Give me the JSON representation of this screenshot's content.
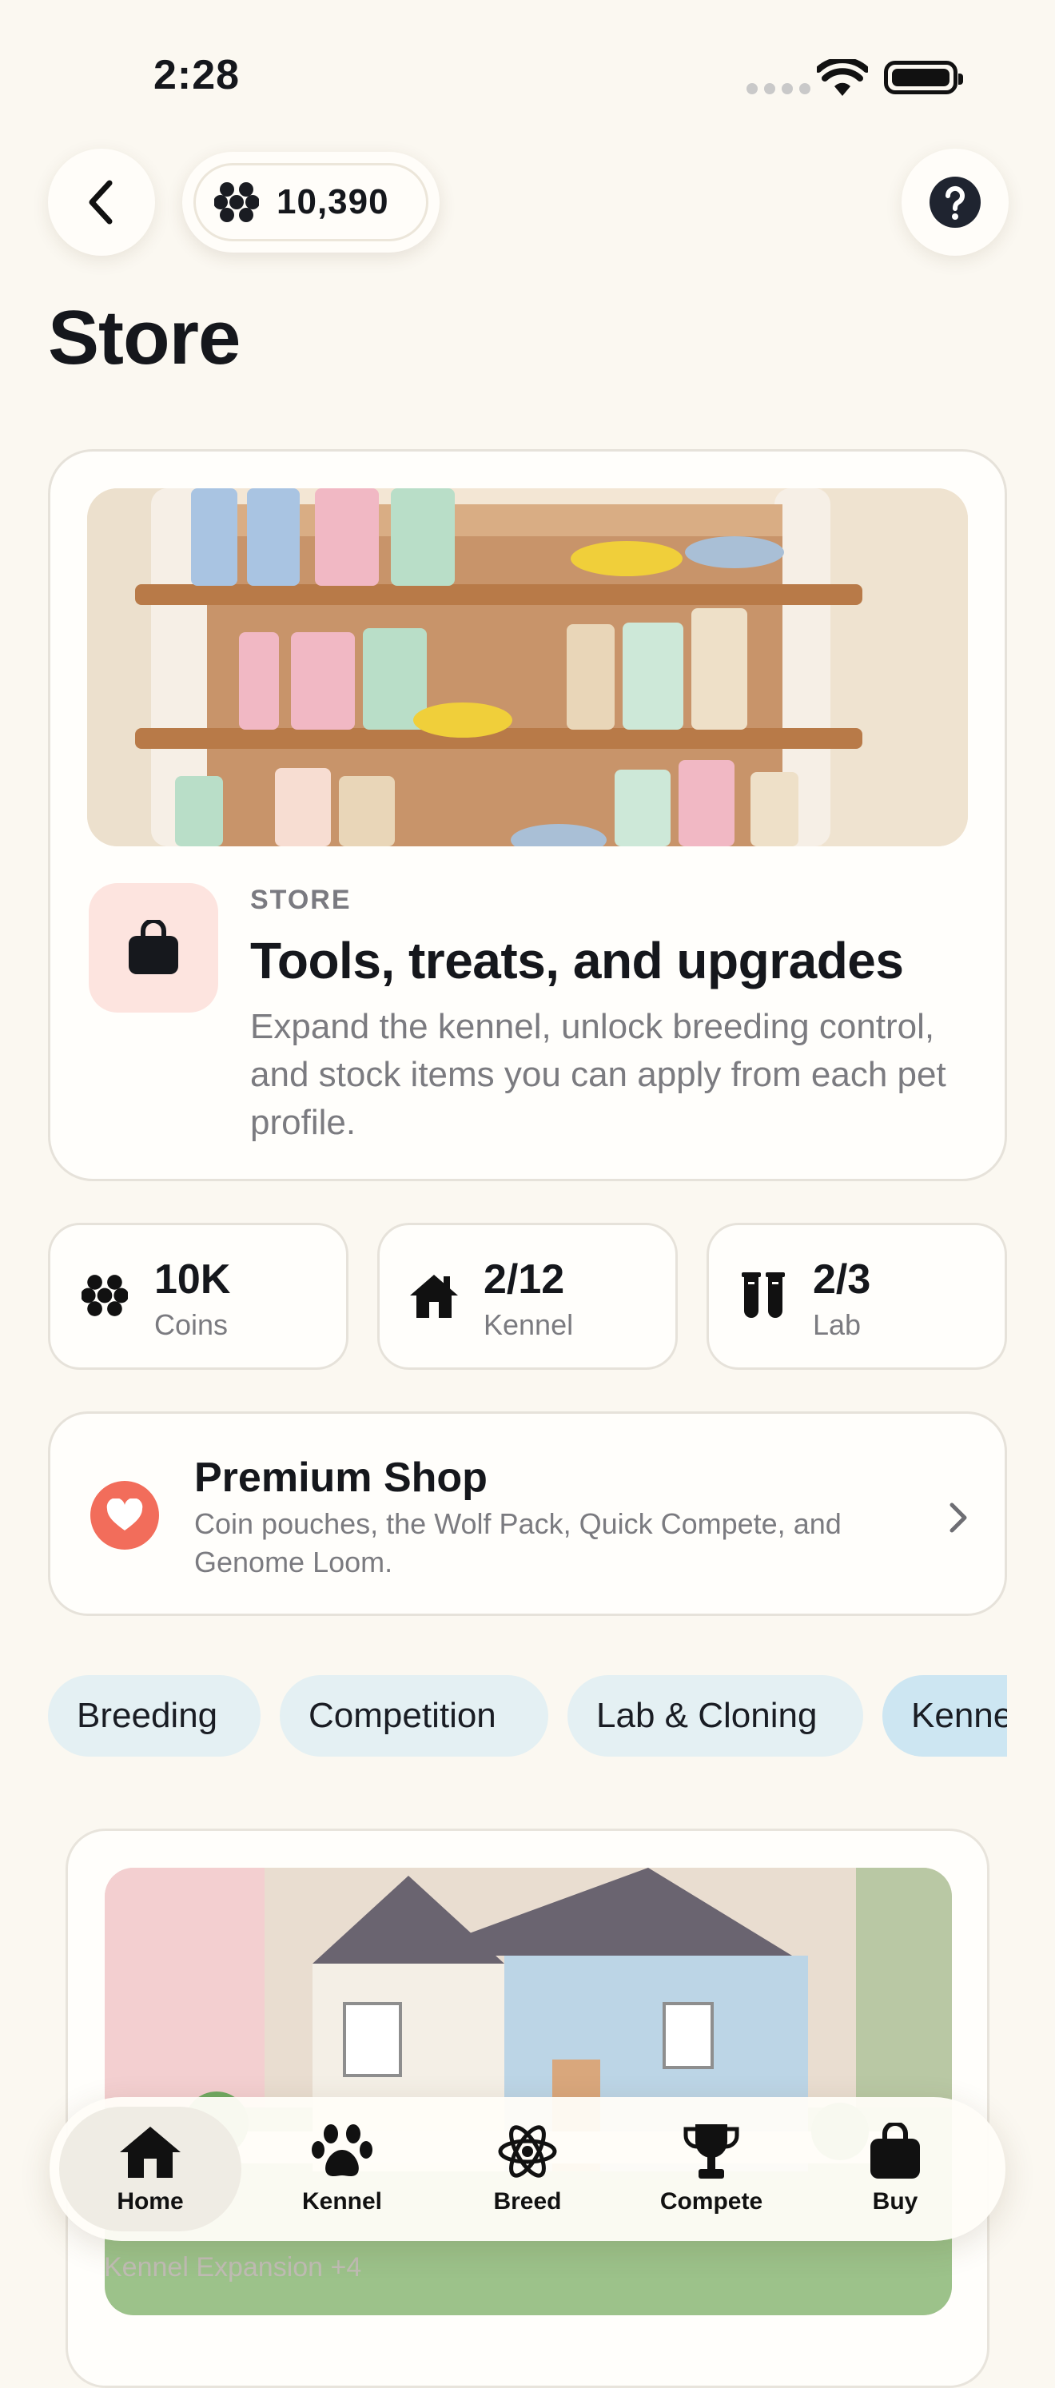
{
  "status_bar": {
    "time": "2:28"
  },
  "header": {
    "coins": "10,390",
    "title": "Store"
  },
  "hero": {
    "eyebrow": "STORE",
    "title": "Tools, treats, and upgrades",
    "description": "Expand the kennel, unlock breeding control, and stock items you can apply from each pet profile."
  },
  "stats": [
    {
      "value": "10K",
      "label": "Coins",
      "icon": "paw-cluster-icon"
    },
    {
      "value": "2/12",
      "label": "Kennel",
      "icon": "house-icon"
    },
    {
      "value": "2/3",
      "label": "Lab",
      "icon": "test-tubes-icon"
    }
  ],
  "premium": {
    "title": "Premium Shop",
    "description": "Coin pouches, the Wolf Pack, Quick Compete, and Genome Loom."
  },
  "chips": [
    {
      "label": "Breeding"
    },
    {
      "label": "Competition"
    },
    {
      "label": "Lab & Cloning"
    },
    {
      "label": "Kennel"
    }
  ],
  "item": {
    "title": "Kennel Expansion +4"
  },
  "nav": [
    {
      "label": "Home",
      "icon": "house-icon",
      "active": true
    },
    {
      "label": "Kennel",
      "icon": "paw-icon"
    },
    {
      "label": "Breed",
      "icon": "atom-icon"
    },
    {
      "label": "Compete",
      "icon": "trophy-icon"
    },
    {
      "label": "Buy",
      "icon": "shopping-bag-icon"
    }
  ],
  "colors": {
    "background": "#fbf8f1",
    "accent_heart": "#f26d5b",
    "chip": "#e4f0f3",
    "bag_tile": "#fde4df"
  }
}
